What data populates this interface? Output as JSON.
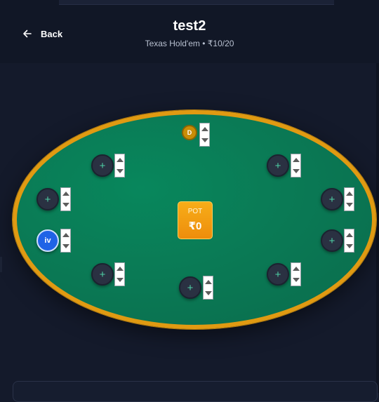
{
  "header": {
    "back_label": "Back",
    "title": "test2",
    "subtitle": "Texas Hold'em • ₹10/20"
  },
  "table": {
    "pot_label": "POT",
    "pot_value": "₹0",
    "dealer_label": "D"
  },
  "seats": [
    {
      "symbol": "+"
    },
    {
      "symbol": "+"
    },
    {
      "symbol": "+"
    },
    {
      "symbol": "+"
    },
    {
      "player": "iv"
    },
    {
      "symbol": "+"
    },
    {
      "symbol": "+"
    },
    {
      "symbol": "+"
    },
    {
      "symbol": "+"
    },
    {
      "symbol": "+"
    }
  ],
  "colors": {
    "background": "#141a2b",
    "felt": "#08875c",
    "rail": "#e09a12",
    "pot": "#f7ad18",
    "player_seat": "#1f63e6",
    "seat_plus": "#4fd1a5"
  },
  "icons": {
    "back": "arrow-left-icon",
    "spinner_up": "triangle-up-icon",
    "spinner_down": "triangle-down-icon"
  }
}
